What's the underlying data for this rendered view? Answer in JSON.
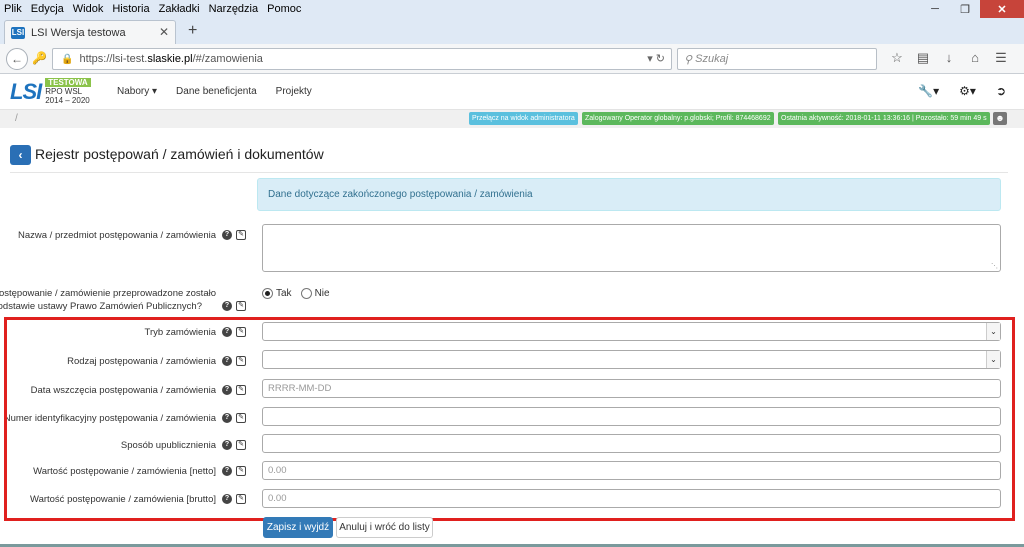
{
  "browser": {
    "menu": [
      "Plik",
      "Edycja",
      "Widok",
      "Historia",
      "Zakładki",
      "Narzędzia",
      "Pomoc"
    ],
    "tab_title": "LSI Wersja testowa",
    "favicon_text": "LSI",
    "url_prefix": "https://lsi-test.",
    "url_host": "slaskie.pl",
    "url_path": "/#/zamowienia",
    "search_placeholder": "Szukaj"
  },
  "app": {
    "logo_main": "LSI",
    "logo_badge": "TESTOWA",
    "logo_line1": "RPO WSL",
    "logo_line2": "2014 – 2020",
    "nav": [
      "Nabory ▾",
      "Dane beneficjenta",
      "Projekty"
    ],
    "status": {
      "slash": "/",
      "admin": "Przełącz na widok administratora",
      "user": "Zalogowany Operator globalny: p.globski; Profil: 874468692",
      "activity": "Ostatnia aktywność: 2018-01-11 13:36:16 | Pozostało: 59 min 49 s"
    }
  },
  "page": {
    "title": "Rejestr postępowań / zamówień i dokumentów",
    "info": "Dane dotyczące zakończonego postępowania / zamówienia",
    "fields": {
      "nazwa": "Nazwa / przedmiot postępowania / zamówienia",
      "pzp_line1": "Czy postępowanie / zamówienie przeprowadzone zostało",
      "pzp_line2": "na podstawie ustawy Prawo Zamówień Publicznych?",
      "tak": "Tak",
      "nie": "Nie",
      "tryb": "Tryb zamówienia",
      "rodzaj": "Rodzaj postępowania / zamówienia",
      "data": "Data wszczęcia postępowania / zamówienia",
      "data_placeholder": "RRRR-MM-DD",
      "numer": "Numer identyfikacyjny postępowania / zamówienia",
      "sposob": "Sposób upublicznienia",
      "netto": "Wartość postępowanie / zamówienia [netto]",
      "netto_placeholder": "0.00",
      "brutto": "Wartość postępowanie / zamówienia [brutto]",
      "brutto_placeholder": "0.00"
    },
    "buttons": {
      "save": "Zapisz i wyjdź",
      "cancel": "Anuluj i wróć do listy"
    }
  }
}
